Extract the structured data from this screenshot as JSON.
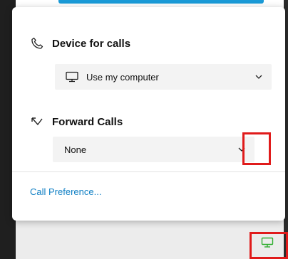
{
  "popup": {
    "device_section": {
      "title": "Device for calls",
      "icon": "phone-icon",
      "dropdown_value": "Use my computer",
      "dropdown_icon": "computer-icon"
    },
    "forward_section": {
      "title": "Forward Calls",
      "icon": "forward-arrow-icon",
      "dropdown_value": "None"
    },
    "link": "Call Preference..."
  },
  "colors": {
    "accent_blue": "#1a9ad7",
    "link": "#0f7fc4",
    "highlight_red": "#e01b1b",
    "status_green": "#2fae2f"
  },
  "taskbar": {
    "status_icon": "computer-status-icon"
  }
}
